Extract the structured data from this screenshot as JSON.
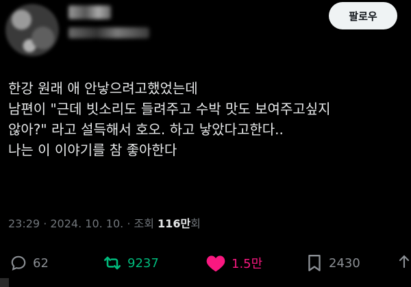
{
  "header": {
    "follow_label": "팔로우"
  },
  "tweet": {
    "lines": [
      "한강 원래 애 안낳으려고했었는데",
      "남편이 \"근데 빗소리도 들려주고 수박 맛도 보여주고싶지",
      "않아?\" 라고 설득해서 호오. 하고 낳았다고한다..",
      "나는 이 이야기를 참 좋아한다"
    ]
  },
  "meta": {
    "time": "23:29",
    "separator": " · ",
    "date": "2024. 10. 10.",
    "views_prefix": "조회 ",
    "views_count": "116만",
    "views_suffix": "회"
  },
  "actions": {
    "reply_count": "62",
    "retweet_count": "9237",
    "like_count": "1.5만",
    "view_count": "2430"
  },
  "colors": {
    "background": "#000000",
    "text": "#e7e9ea",
    "muted": "#71767b",
    "retweet": "#00ba7c",
    "like": "#f91880"
  },
  "icons": [
    "reply-icon",
    "retweet-icon",
    "like-heart-icon",
    "bookmark-icon",
    "share-icon"
  ]
}
